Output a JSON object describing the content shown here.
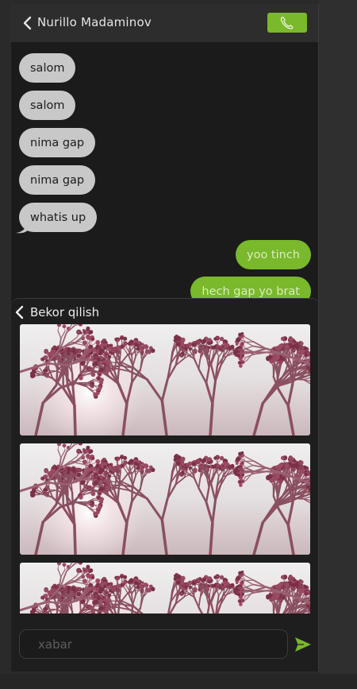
{
  "header": {
    "contact_name": "Nurillo Madaminov",
    "back_icon": "chevron-left-icon",
    "call_icon": "phone-icon"
  },
  "messages": [
    {
      "text": "salom",
      "direction": "incoming"
    },
    {
      "text": "salom",
      "direction": "incoming"
    },
    {
      "text": "nima gap",
      "direction": "incoming"
    },
    {
      "text": "nima gap",
      "direction": "incoming"
    },
    {
      "text": "whatis up",
      "direction": "incoming"
    },
    {
      "text": "yoo tinch",
      "direction": "outgoing"
    },
    {
      "text": "hech gap yo brat",
      "direction": "outgoing"
    }
  ],
  "picker": {
    "cancel_label": "Bekor qilish",
    "photo_count_visible": 3
  },
  "composer": {
    "placeholder": "xabar",
    "value": ""
  },
  "colors": {
    "accent": "#7ab82c",
    "incoming_bubble": "#c8c8c8",
    "background": "#1b1b1b",
    "header": "#2d2d2d"
  }
}
